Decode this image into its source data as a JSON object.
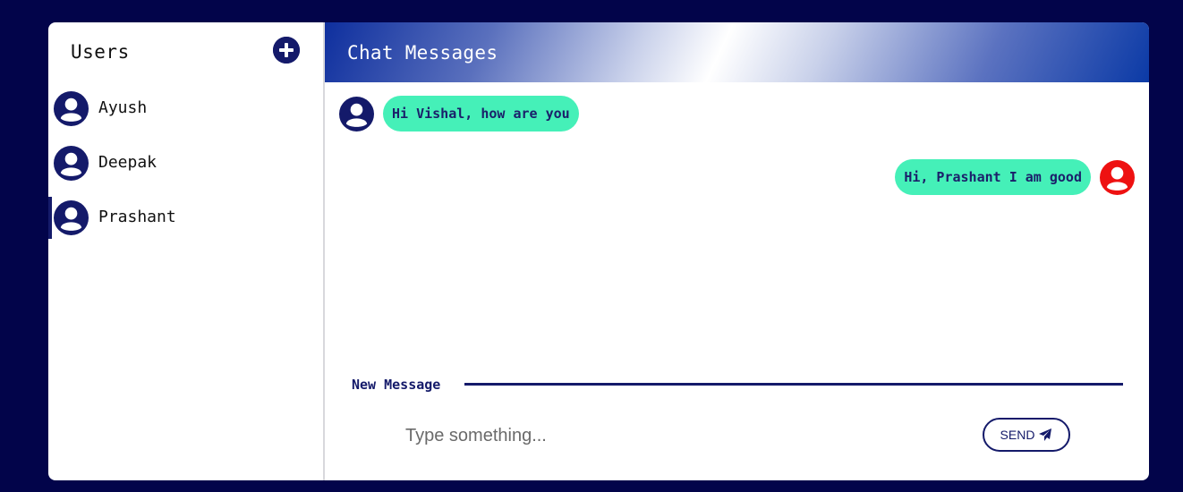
{
  "sidebar": {
    "title": "Users",
    "add_icon": "plus-circle-icon",
    "users": [
      {
        "name": "Ayush",
        "active": false
      },
      {
        "name": "Deepak",
        "active": false
      },
      {
        "name": "Prashant",
        "active": true
      }
    ]
  },
  "chat": {
    "title": "Chat Messages",
    "messages": [
      {
        "text": "Hi Vishal, how are you",
        "side": "left",
        "avatar_color": "#141a6a"
      },
      {
        "text": "Hi, Prashant I am good",
        "side": "right",
        "avatar_color": "#ee1111"
      }
    ]
  },
  "composer": {
    "label": "New Message",
    "placeholder": "Type something...",
    "value": "",
    "send_label": "SEND",
    "send_icon": "paper-plane-icon"
  },
  "colors": {
    "background": "#02044a",
    "accent": "#141a6a",
    "bubble": "#45f0b8",
    "other_avatar": "#ee1111"
  }
}
